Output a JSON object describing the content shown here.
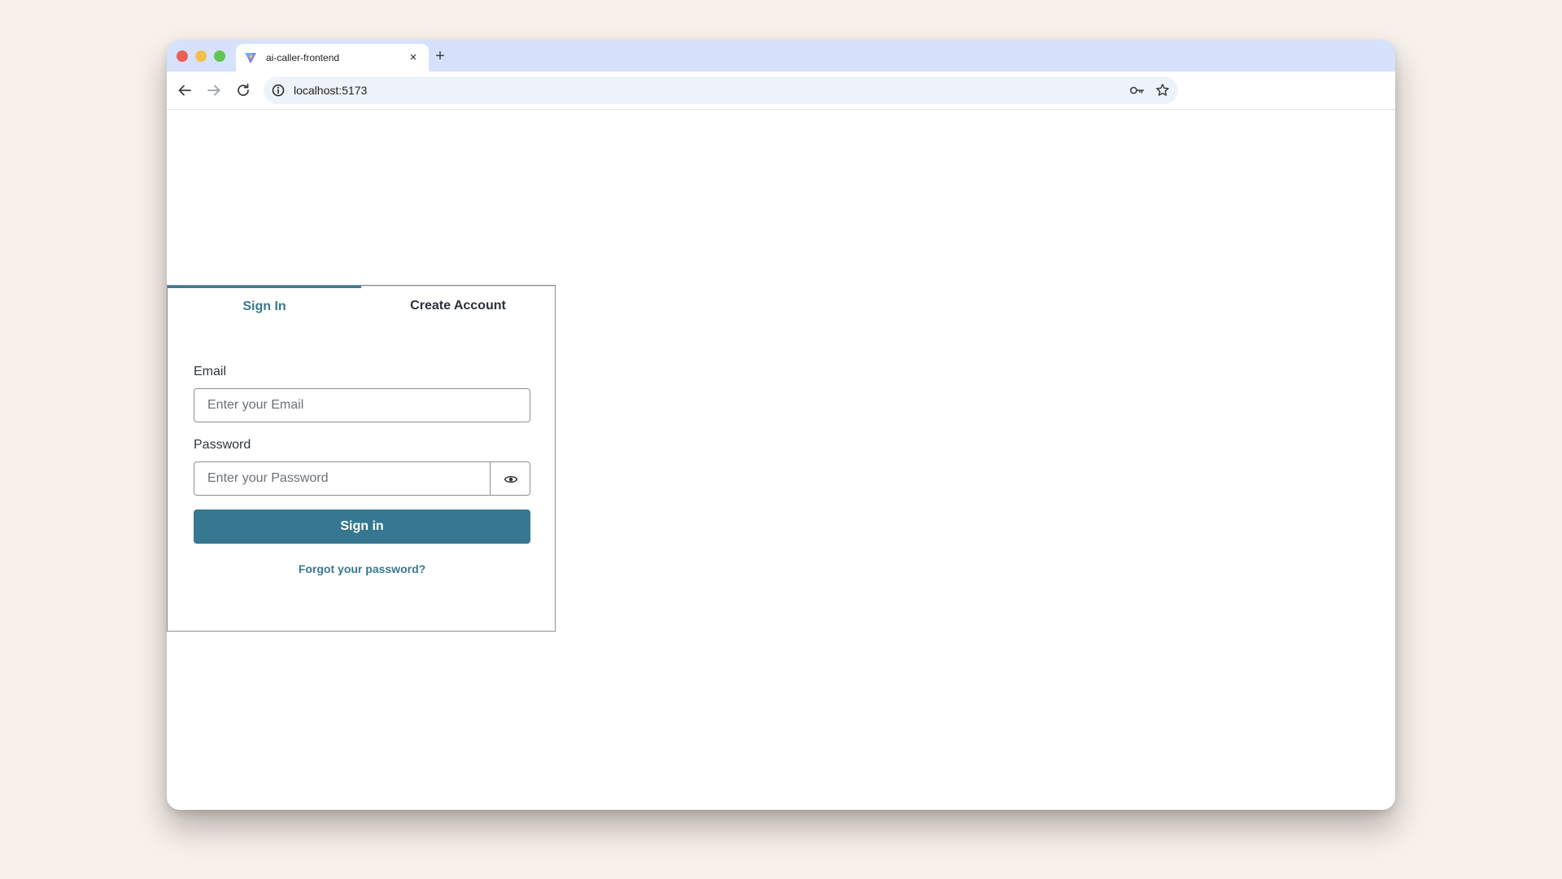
{
  "browser": {
    "tab_title": "ai-caller-frontend",
    "tab_close": "×",
    "new_tab": "+",
    "url": "localhost:5173"
  },
  "auth": {
    "tabs": [
      {
        "label": "Sign In",
        "active": true
      },
      {
        "label": "Create Account",
        "active": false
      }
    ],
    "email_label": "Email",
    "email_placeholder": "Enter your Email",
    "password_label": "Password",
    "password_placeholder": "Enter your Password",
    "submit_label": "Sign in",
    "forgot_label": "Forgot your password?"
  },
  "colors": {
    "accent": "#367891",
    "tabbar": "#d6e2fb",
    "background": "#f8f0ea"
  },
  "icons": {
    "tab_favicon": "vite-logo-icon",
    "back": "arrow-left-icon",
    "forward": "arrow-right-icon",
    "reload": "reload-icon",
    "site_info": "info-icon",
    "password_manager": "key-icon",
    "bookmark": "star-icon",
    "password_toggle": "eye-icon"
  }
}
